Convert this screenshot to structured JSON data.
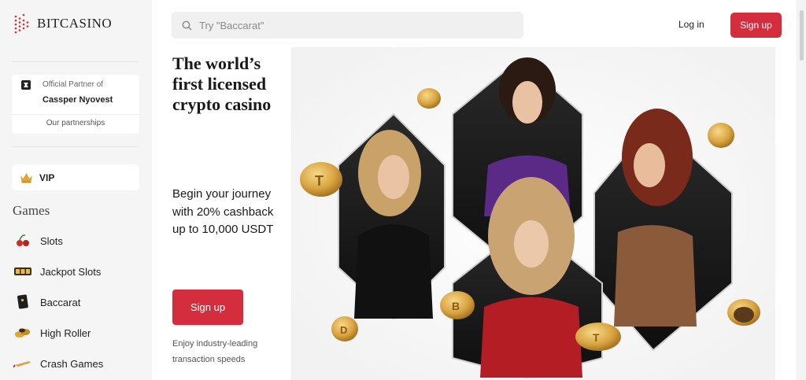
{
  "brand": {
    "name": "BITCASINO"
  },
  "partner": {
    "label": "Official Partner of",
    "name": "Cassper Nyovest",
    "link": "Our partnerships"
  },
  "vip": {
    "label": "VIP"
  },
  "games": {
    "title": "Games",
    "items": [
      {
        "label": "Slots",
        "icon": "slots-icon"
      },
      {
        "label": "Jackpot Slots",
        "icon": "jackpot-icon"
      },
      {
        "label": "Baccarat",
        "icon": "baccarat-icon"
      },
      {
        "label": "High Roller",
        "icon": "high-roller-icon"
      },
      {
        "label": "Crash Games",
        "icon": "crash-icon"
      }
    ]
  },
  "header": {
    "search_placeholder": "Try \"Baccarat\"",
    "login_label": "Log in",
    "signup_label": "Sign up"
  },
  "hero": {
    "title": "The world’s first licensed crypto casino",
    "subtitle": "Begin your journey with 20% cashback up to 10,000 USDT",
    "cta_label": "Sign up",
    "footnote": "Enjoy industry-leading transaction speeds"
  },
  "colors": {
    "accent": "#d42e3e",
    "sidebar_bg": "#f5f5f5",
    "gold": "#d9a441"
  }
}
